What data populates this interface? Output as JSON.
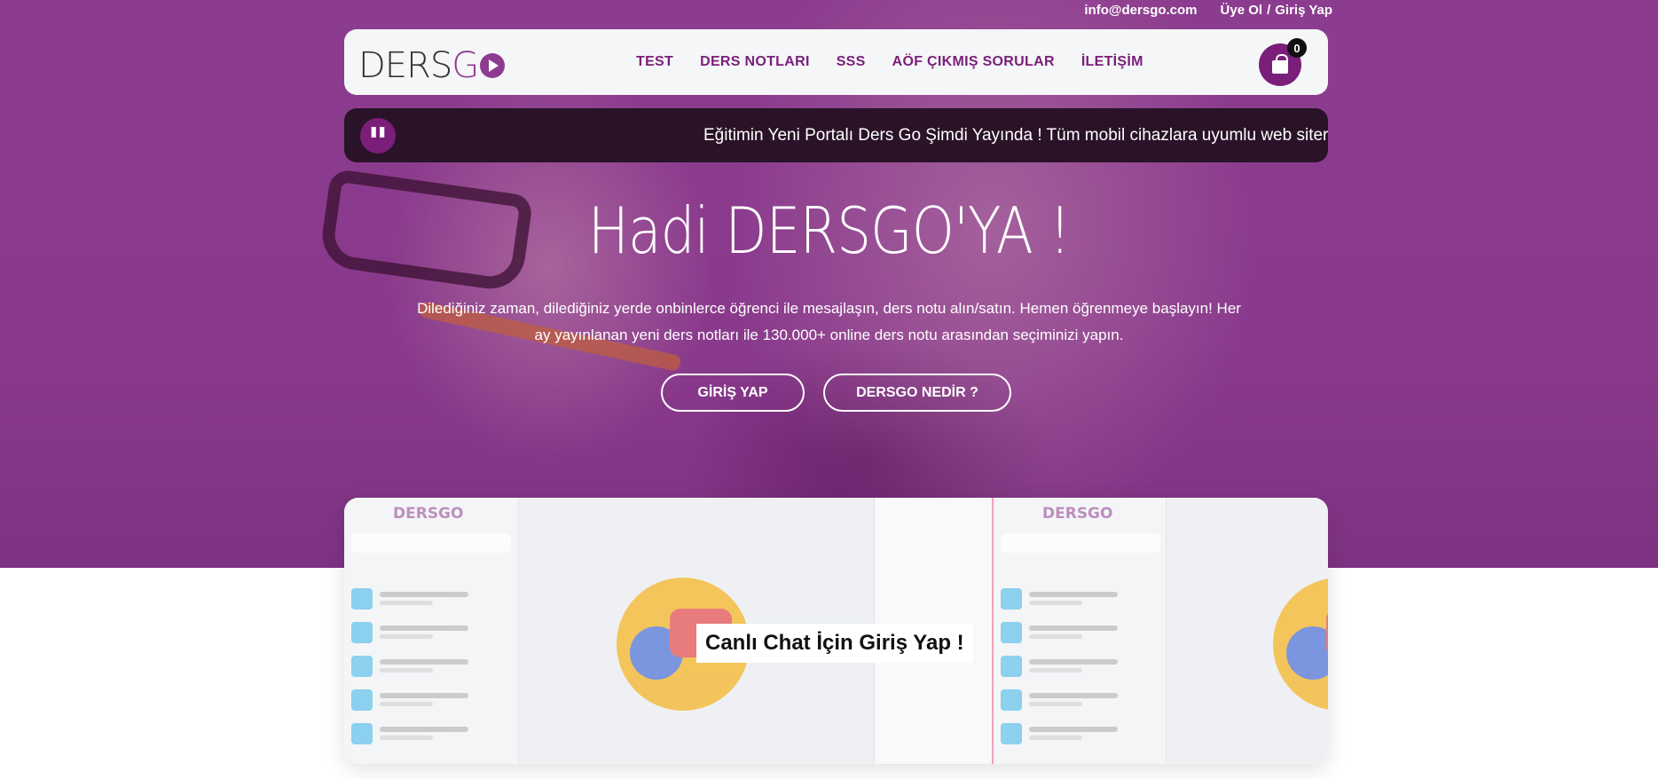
{
  "topbar": {
    "email": "info@dersgo.com",
    "register": "Üye Ol",
    "separator": "/",
    "login": "Giriş Yap"
  },
  "brand": {
    "logo_part1": "DERS",
    "logo_part2": "G",
    "accent_color": "#8e3b8f"
  },
  "nav": {
    "items": [
      {
        "label": "TEST"
      },
      {
        "label": "DERS NOTLARI"
      },
      {
        "label": "SSS"
      },
      {
        "label": "AÖF ÇIKMIŞ SORULAR"
      },
      {
        "label": "İLETİŞİM"
      }
    ]
  },
  "cart": {
    "icon": "shopping-bag-icon",
    "count": "0"
  },
  "ticker": {
    "icon": "quote-icon",
    "text": "Eğitimin Yeni Portalı Ders Go Şimdi Yayında ! Tüm mobil cihazlara uyumlu web siter"
  },
  "hero": {
    "title": "Hadi DERSGO'YA !",
    "lead": "Dilediğiniz zaman, dilediğiniz yerde onbinlerce öğrenci ile mesajlaşın, ders notu alın/satın. Hemen öğrenmeye başlayın! Her ay yayınlanan yeni ders notları ile 130.000+ online ders notu arasından seçiminizi yapın.",
    "login_button": "GİRİŞ YAP",
    "about_button": "DERSGO NEDİR ?"
  },
  "chat": {
    "cta": "Canlı Chat İçin Giriş Yap !"
  }
}
